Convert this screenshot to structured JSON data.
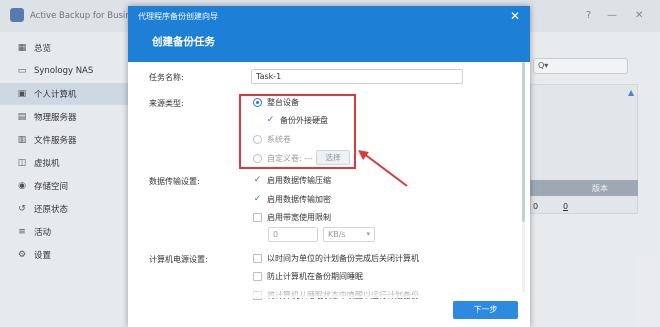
{
  "app": {
    "title": "Active Backup for Business",
    "window_buttons": {
      "help": "?",
      "minimize": "—",
      "close": "✕"
    },
    "sidebar": [
      {
        "label": "总览",
        "icon": "overview-icon",
        "glyph": "▦"
      },
      {
        "label": "Synology NAS",
        "icon": "nas-icon",
        "glyph": "▭"
      },
      {
        "label": "个人计算机",
        "icon": "pc-icon",
        "glyph": "▣",
        "active": true
      },
      {
        "label": "物理服务器",
        "icon": "server-icon",
        "glyph": "▤"
      },
      {
        "label": "文件服务器",
        "icon": "file-server-icon",
        "glyph": "▥"
      },
      {
        "label": "虚拟机",
        "icon": "vm-icon",
        "glyph": "◫"
      },
      {
        "label": "存储空间",
        "icon": "storage-icon",
        "glyph": "◉"
      },
      {
        "label": "还原状态",
        "icon": "restore-icon",
        "glyph": "↺"
      },
      {
        "label": "活动",
        "icon": "activity-icon",
        "glyph": "≡"
      },
      {
        "label": "设置",
        "icon": "settings-icon",
        "glyph": "⚙"
      }
    ],
    "right_panel": {
      "search_prefix": "Q▾",
      "column_header": "版本",
      "cell_count": "0",
      "cell_version": "0"
    }
  },
  "dialog": {
    "top_title": "代理程序备份创建向导",
    "title": "创建备份任务",
    "close": "✕",
    "task_name": {
      "label": "任务名称:",
      "value": "Task-1"
    },
    "source_type": {
      "label": "来源类型:",
      "whole_device": "整台设备",
      "backup_external": "备份外接硬盘",
      "system_volume": "系统卷",
      "custom_volume": "自定义卷: ---",
      "select_button": "选择"
    },
    "transfer": {
      "label": "数据传输设置:",
      "compression": "启用数据传输压缩",
      "encryption": "启用数据传输加密",
      "bandwidth": "启用带宽使用限制",
      "bandwidth_value": "0",
      "bandwidth_unit": "KB/s"
    },
    "power": {
      "label": "计算机电源设置:",
      "shutdown": "以时间为单位的计划备份完成后关闭计算机",
      "prevent_sleep": "防止计算机在备份期间睡眠",
      "wake": "将计算机从睡眠状态中唤醒以运行计划备份"
    },
    "next_button": "下一步"
  },
  "colors": {
    "accent": "#1e7fd6",
    "annotation": "#d93a3a"
  }
}
